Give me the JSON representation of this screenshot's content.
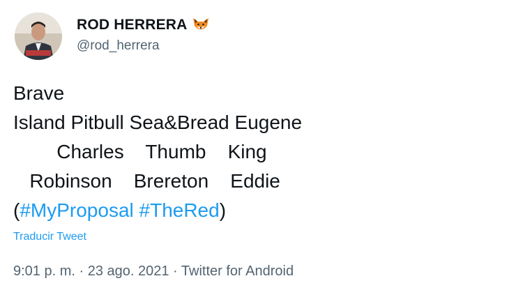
{
  "author": {
    "display_name": "ROD HERRERA",
    "emoji": "🦊",
    "handle": "@rod_herrera"
  },
  "tweet": {
    "lines": [
      "Brave",
      "Island Pitbull Sea&Bread Eugene",
      "        Charles    Thumb    King",
      "   Robinson    Brereton    Eddie"
    ],
    "last_line_open": "(",
    "hashtag_1": "#MyProposal",
    "hashtag_sep": " ",
    "hashtag_2": "#TheRed",
    "last_line_close": ")"
  },
  "translate_label": "Traducir Tweet",
  "meta": {
    "time": "9:01 p. m.",
    "sep1": " · ",
    "date": "23 ago. 2021",
    "sep2": " · ",
    "source": "Twitter for Android"
  },
  "colors": {
    "link": "#1d9bf0",
    "secondary_text": "#536471",
    "primary_text": "#0f1419"
  },
  "icons": {
    "avatar": "profile-photo",
    "emoji": "fox-face-icon"
  }
}
